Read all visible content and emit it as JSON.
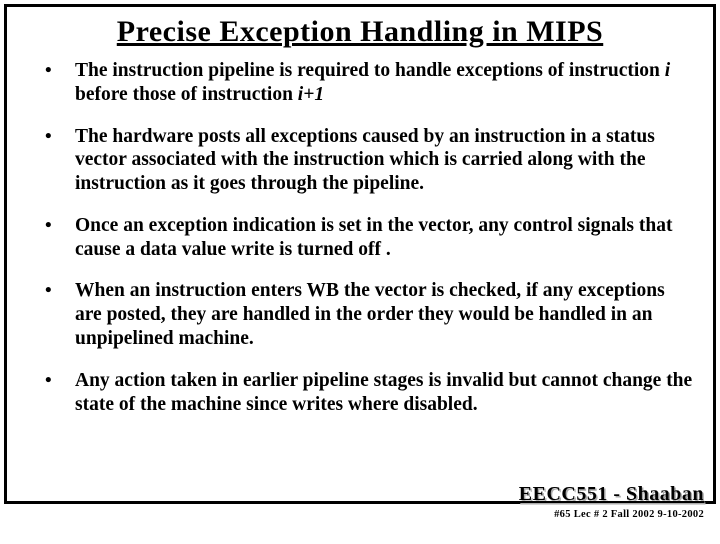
{
  "title": "Precise Exception Handling in MIPS",
  "bullets": [
    {
      "pre": "The instruction pipeline is required to handle exceptions of instruction ",
      "em1": "i",
      "mid": "  before those of instruction  ",
      "em2": "i+1",
      "post": ""
    },
    {
      "pre": "The hardware posts all exceptions caused by an instruction in a status vector associated with the instruction which is carried along with the instruction as it goes through the pipeline.",
      "em1": "",
      "mid": "",
      "em2": "",
      "post": ""
    },
    {
      "pre": "Once an exception indication is set in the vector, any control signals that cause a data value write is turned off .",
      "em1": "",
      "mid": "",
      "em2": "",
      "post": ""
    },
    {
      "pre": "When an instruction enters WB the vector is checked, if any exceptions are posted, they are handled in the order they would be handled in an unpipelined machine.",
      "em1": "",
      "mid": "",
      "em2": "",
      "post": ""
    },
    {
      "pre": "Any action taken in earlier pipeline stages is invalid but cannot change the state of the machine since writes where disabled.",
      "em1": "",
      "mid": "",
      "em2": "",
      "post": ""
    }
  ],
  "footer": {
    "course": "EECC551 - Shaaban",
    "meta": "#65  Lec # 2  Fall 2002   9-10-2002"
  }
}
